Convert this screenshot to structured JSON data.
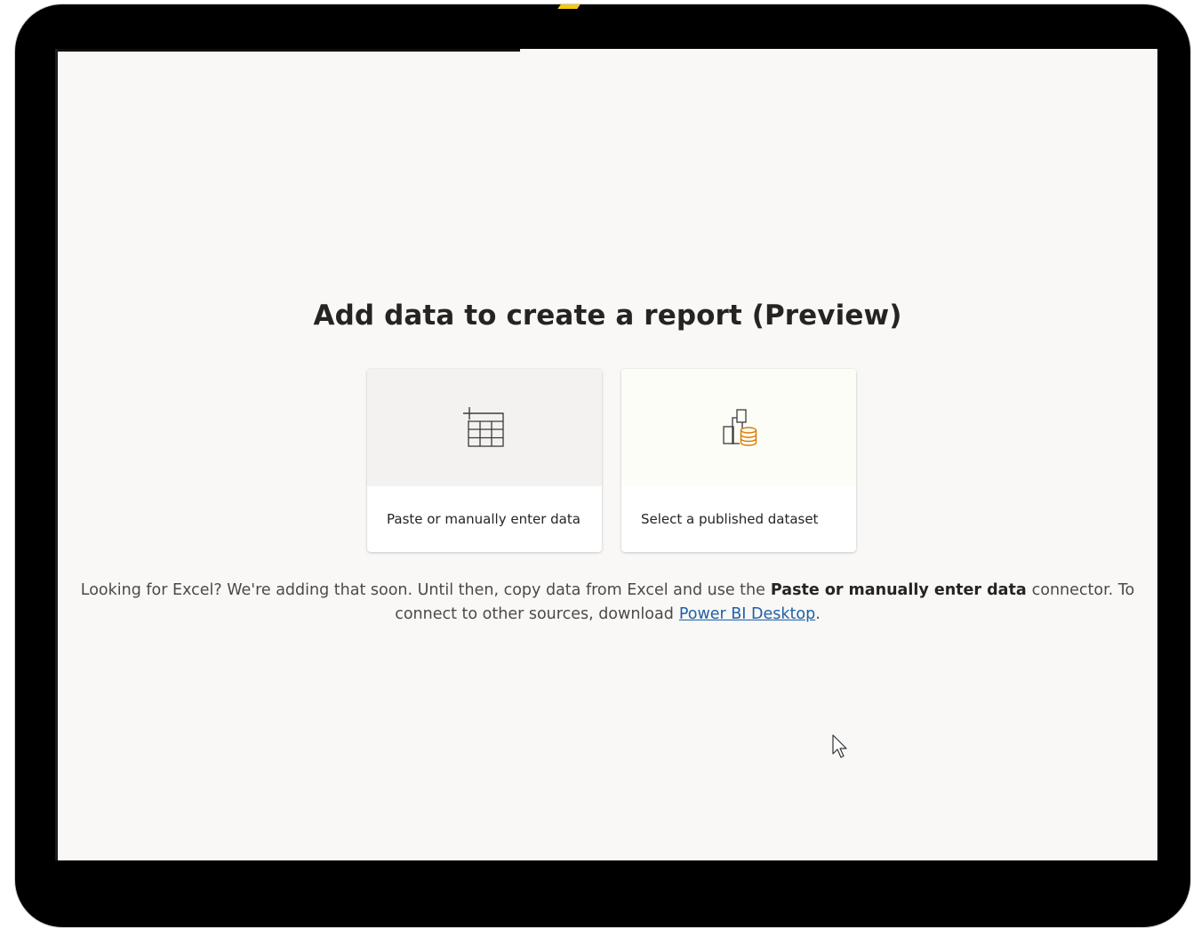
{
  "page": {
    "title": "Add data to create a report (Preview)"
  },
  "cards": [
    {
      "label": "Paste or manually enter data",
      "icon": "table-add-icon"
    },
    {
      "label": "Select a published dataset",
      "icon": "dataset-icon"
    }
  ],
  "info": {
    "text_before": "Looking for Excel? We're adding that soon. Until then, copy data from Excel and use the",
    "bold": "Paste or manually enter data",
    "text_middle": "connector. To connect to other sources, download",
    "link": "Power BI Desktop",
    "text_after": "."
  },
  "colors": {
    "accent": "#f2c811",
    "link": "#1f5fa8",
    "dataset_icon": "#d97a00"
  }
}
